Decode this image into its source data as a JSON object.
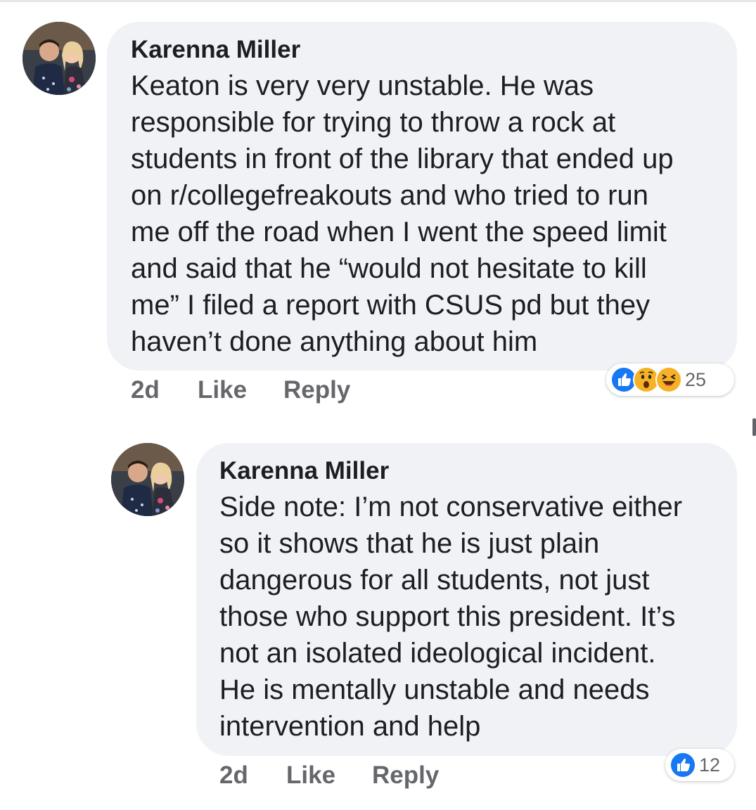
{
  "comments": [
    {
      "author": "Karenna Miller",
      "lines": [
        "Keaton is very very unstable. He was",
        "responsible for trying to throw a rock at",
        "students in front of the library that ended up",
        "on r/collegefreakouts and who tried to run",
        "me off the road when I went the speed limit",
        "and said that he “would not hesitate to kill",
        "me” I filed a report with CSUS pd but they",
        "haven’t done anything about him"
      ],
      "time": "2d",
      "like_label": "Like",
      "reply_label": "Reply",
      "reactions": [
        "like-icon",
        "wow-icon",
        "haha-icon"
      ],
      "reaction_count": "25"
    },
    {
      "author": "Karenna Miller",
      "lines": [
        "Side note: I’m not conservative either",
        "so it shows that he is just plain",
        "dangerous for all students, not just",
        "those who support this president. It’s",
        "not an isolated ideological incident.",
        "He is mentally unstable and needs",
        "intervention and help"
      ],
      "time": "2d",
      "like_label": "Like",
      "reply_label": "Reply",
      "reactions": [
        "like-icon"
      ],
      "reaction_count": "12"
    }
  ],
  "colors": {
    "bubble": "#f0f2f5",
    "meta_text": "#65676b",
    "like_blue": "#1877f2",
    "emoji_yellow": "#f7b125"
  }
}
